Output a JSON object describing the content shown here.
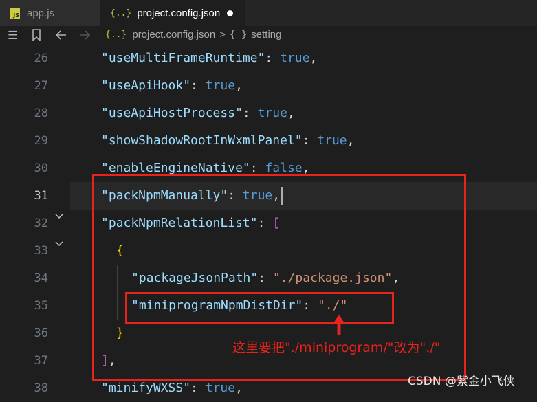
{
  "tabs": [
    {
      "label": "app.js",
      "icon": "js-file-icon",
      "badge": "JS"
    },
    {
      "label": "project.config.json",
      "icon": "json-file-icon",
      "badge": "{..}",
      "modified": true
    }
  ],
  "breadcrumb": {
    "file_badge": "{..}",
    "file": "project.config.json",
    "separator": ">",
    "object_badge": "{ }",
    "section": "setting"
  },
  "editor": {
    "active_line": "31",
    "lines": [
      {
        "num": "26",
        "key": "\"useMultiFrameRuntime\"",
        "colon": ": ",
        "value": "true",
        "tail": ","
      },
      {
        "num": "27",
        "key": "\"useApiHook\"",
        "colon": ": ",
        "value": "true",
        "tail": ","
      },
      {
        "num": "28",
        "key": "\"useApiHostProcess\"",
        "colon": ": ",
        "value": "true",
        "tail": ","
      },
      {
        "num": "29",
        "key": "\"showShadowRootInWxmlPanel\"",
        "colon": ": ",
        "value": "true",
        "tail": ","
      },
      {
        "num": "30",
        "key": "\"enableEngineNative\"",
        "colon": ": ",
        "value": "false",
        "tail": ","
      },
      {
        "num": "31",
        "key": "\"packNpmManually\"",
        "colon": ": ",
        "value": "true",
        "tail": ","
      },
      {
        "num": "32",
        "key": "\"packNpmRelationList\"",
        "colon": ": ",
        "value": "[",
        "tail": ""
      },
      {
        "num": "33",
        "key": "",
        "colon": "",
        "value": "{",
        "tail": ""
      },
      {
        "num": "34",
        "key": "\"packageJsonPath\"",
        "colon": ": ",
        "value": "\"./package.json\"",
        "tail": ","
      },
      {
        "num": "35",
        "key": "\"miniprogramNpmDistDir\"",
        "colon": ": ",
        "value": "\"./\"",
        "tail": ""
      },
      {
        "num": "36",
        "key": "",
        "colon": "",
        "value": "}",
        "tail": ""
      },
      {
        "num": "37",
        "key": "",
        "colon": "",
        "value": "]",
        "tail": ","
      },
      {
        "num": "38",
        "key": "\"minifyWXSS\"",
        "colon": ": ",
        "value": "true",
        "tail": ","
      }
    ]
  },
  "annotation": "这里要把\"./miniprogram/\"改为\"./\"",
  "watermark": "CSDN @紫金小飞侠",
  "colors": {
    "annotation": "#e8231c",
    "key": "#9cdcfe",
    "string": "#ce9178",
    "boolean": "#569cd6"
  }
}
